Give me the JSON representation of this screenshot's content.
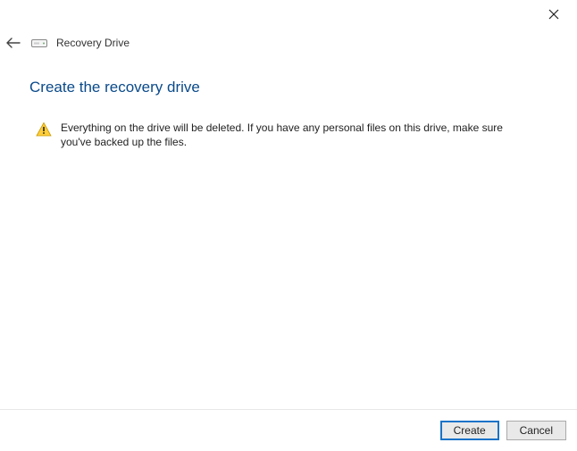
{
  "window": {
    "title": "Recovery Drive"
  },
  "page": {
    "heading": "Create the recovery drive",
    "warning_text": "Everything on the drive will be deleted. If you have any personal files on this drive, make sure you've backed up the files."
  },
  "buttons": {
    "primary": "Create",
    "cancel": "Cancel"
  },
  "icons": {
    "close": "close-icon",
    "back": "back-arrow-icon",
    "drive": "drive-icon",
    "warning": "warning-icon"
  }
}
